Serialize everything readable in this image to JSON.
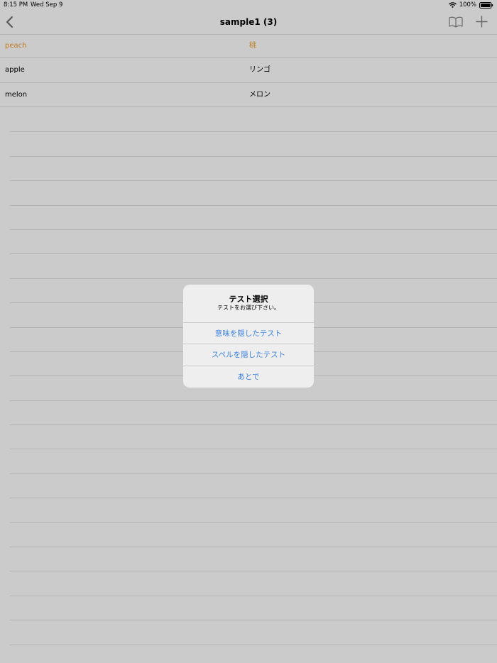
{
  "status_bar": {
    "time": "8:15 PM",
    "date": "Wed Sep 9",
    "battery": "100%",
    "icons": [
      "wifi-icon",
      "battery-icon"
    ]
  },
  "nav": {
    "title": "sample1 (3)",
    "icons": [
      "chevron-left-icon",
      "book-icon",
      "plus-icon"
    ]
  },
  "words": [
    {
      "en": "peach",
      "ja": "桃",
      "highlighted": true
    },
    {
      "en": "apple",
      "ja": "リンゴ",
      "highlighted": false
    },
    {
      "en": "melon",
      "ja": "メロン",
      "highlighted": false
    }
  ],
  "alert": {
    "title": "テスト選択",
    "message": "テストをお選び下さい。",
    "actions": [
      "意味を隠したテスト",
      "スペルを隠したテスト",
      "あとで"
    ]
  },
  "colors": {
    "background": "#cbcbcb",
    "highlight": "#c07a1c",
    "action_blue": "#3e82e0"
  }
}
